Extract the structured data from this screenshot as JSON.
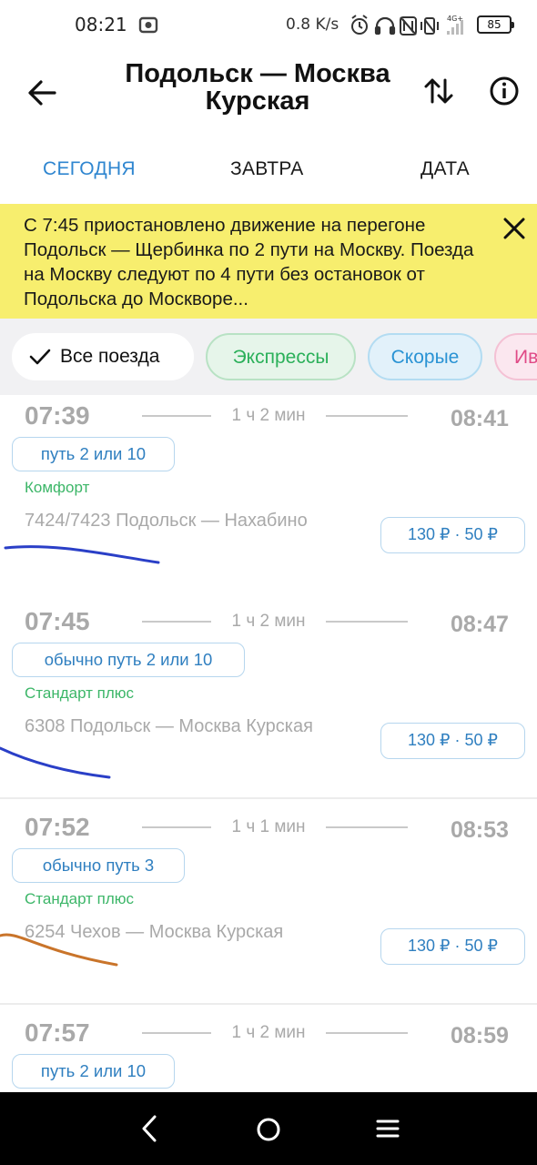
{
  "status_bar": {
    "time": "08:21",
    "network_speed": "0.8 K/s",
    "network_type": "4G+",
    "battery": "85",
    "icons": [
      "camera-app-icon",
      "alarm-icon",
      "headphones-icon",
      "nfc-icon",
      "vibrate-icon",
      "signal-icon"
    ]
  },
  "header": {
    "title_line1": "Подольск — Москва",
    "title_line2": "Курская"
  },
  "tabs": {
    "today": "СЕГОДНЯ",
    "tomorrow": "ЗАВТРА",
    "date": "ДАТА",
    "active": "today"
  },
  "alert": {
    "text": "С 7:45 приостановлено движение на перегоне Подольск — Щербинка по 2 пути на Москву. Поезда на Москву следуют по 4 пути без остановок от Подольска до Москворе..."
  },
  "filters": {
    "all": "Все поезда",
    "express": "Экспрессы",
    "fast": "Скорые",
    "partial": "Ив"
  },
  "trains": [
    {
      "departure": "07:39",
      "duration": "1 ч 2 мин",
      "arrival": "08:41",
      "platform": "путь 2 или 10",
      "category": "Комфорт",
      "route": "7424/7423 Подольск — Нахабино",
      "price": "130 ₽ · 50 ₽"
    },
    {
      "departure": "07:45",
      "duration": "1 ч 2 мин",
      "arrival": "08:47",
      "platform": "обычно путь 2 или 10",
      "category": "Стандарт плюс",
      "route": "6308 Подольск — Москва Курская",
      "price": "130 ₽ · 50 ₽"
    },
    {
      "departure": "07:52",
      "duration": "1 ч 1 мин",
      "arrival": "08:53",
      "platform": "обычно путь 3",
      "category": "Стандарт плюс",
      "route": "6254 Чехов — Москва Курская",
      "price": "130 ₽ · 50 ₽"
    },
    {
      "departure": "07:57",
      "duration": "1 ч 2 мин",
      "arrival": "08:59",
      "platform": "путь 2 или 10"
    }
  ],
  "colors": {
    "accent_blue": "#2f86d0",
    "alert_yellow": "#f7ee6e",
    "category_green": "#3cb668",
    "muted_gray": "#a9a9a9"
  }
}
